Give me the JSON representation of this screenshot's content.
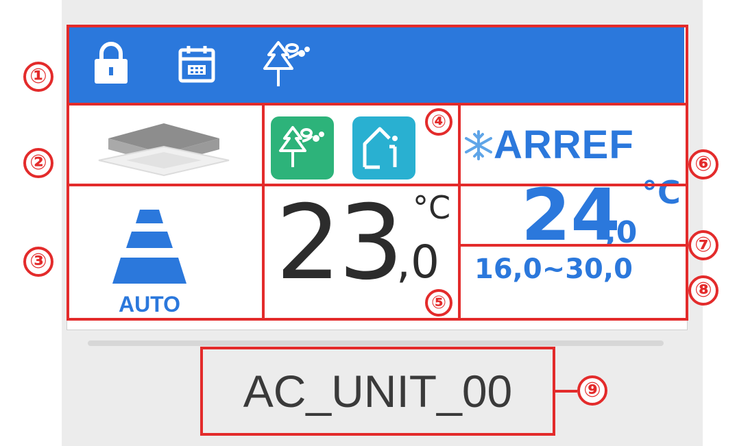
{
  "header": {
    "icons": [
      "lock-icon",
      "calendar-icon",
      "tree-leaf-icon"
    ]
  },
  "indoor_unit": {
    "icon": "ceiling-cassette-icon"
  },
  "fan": {
    "mode_label": "AUTO",
    "icon": "fan-speed-icon"
  },
  "status_icons": [
    {
      "name": "eco-tree-icon",
      "color": "#2db37a"
    },
    {
      "name": "home-info-icon",
      "color": "#29b0d1"
    }
  ],
  "mode": {
    "label": "ARREF",
    "icon": "snowflake-icon"
  },
  "current_temperature": {
    "integer": "23",
    "decimal": ",0",
    "unit": "°C"
  },
  "set_temperature": {
    "integer": "24",
    "decimal": ",0",
    "unit": "°C"
  },
  "range": {
    "text": "16,0~30,0"
  },
  "unit_name": "AC_UNIT_00",
  "callouts": [
    "①",
    "②",
    "③",
    "④",
    "⑤",
    "⑥",
    "⑦",
    "⑧",
    "⑨"
  ],
  "colors": {
    "accent": "#2b78dc",
    "callout": "#e32b2b",
    "eco": "#2db37a",
    "info": "#29b0d1"
  }
}
